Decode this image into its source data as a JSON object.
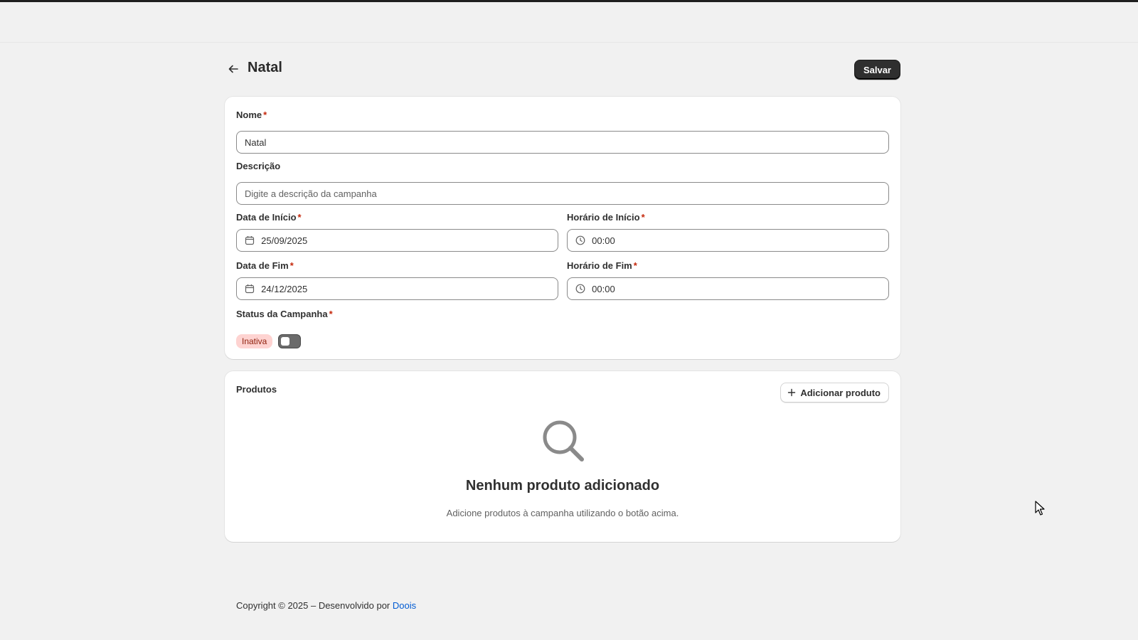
{
  "page": {
    "title": "Natal",
    "save_label": "Salvar"
  },
  "form": {
    "name": {
      "label": "Nome",
      "required": "*",
      "value": "Natal"
    },
    "description": {
      "label": "Descrição",
      "placeholder": "Digite a descrição da campanha"
    },
    "start_date": {
      "label": "Data de Início",
      "required": "*",
      "value": "25/09/2025"
    },
    "start_time": {
      "label": "Horário de Início",
      "required": "*",
      "value": "00:00"
    },
    "end_date": {
      "label": "Data de Fim",
      "required": "*",
      "value": "24/12/2025"
    },
    "end_time": {
      "label": "Horário de Fim",
      "required": "*",
      "value": "00:00"
    },
    "status": {
      "label": "Status da Campanha",
      "required": "*",
      "badge": "Inativa",
      "enabled": false
    }
  },
  "products": {
    "title": "Produtos",
    "add_label": "Adicionar produto",
    "empty_title": "Nenhum produto adicionado",
    "empty_desc": "Adicione produtos à campanha utilizando o botão acima."
  },
  "footer": {
    "text": "Copyright © 2025 – Desenvolvido por",
    "link": "Doois"
  },
  "colors": {
    "primary_button": "#2f2f2f",
    "required": "#c5280c",
    "badge_bg": "#fed3d1",
    "badge_text": "#8e1f0b",
    "link": "#005bd3"
  },
  "icons": {
    "back": "arrow-left-icon",
    "calendar": "calendar-icon",
    "clock": "clock-icon",
    "plus": "plus-icon",
    "search": "search-icon"
  }
}
